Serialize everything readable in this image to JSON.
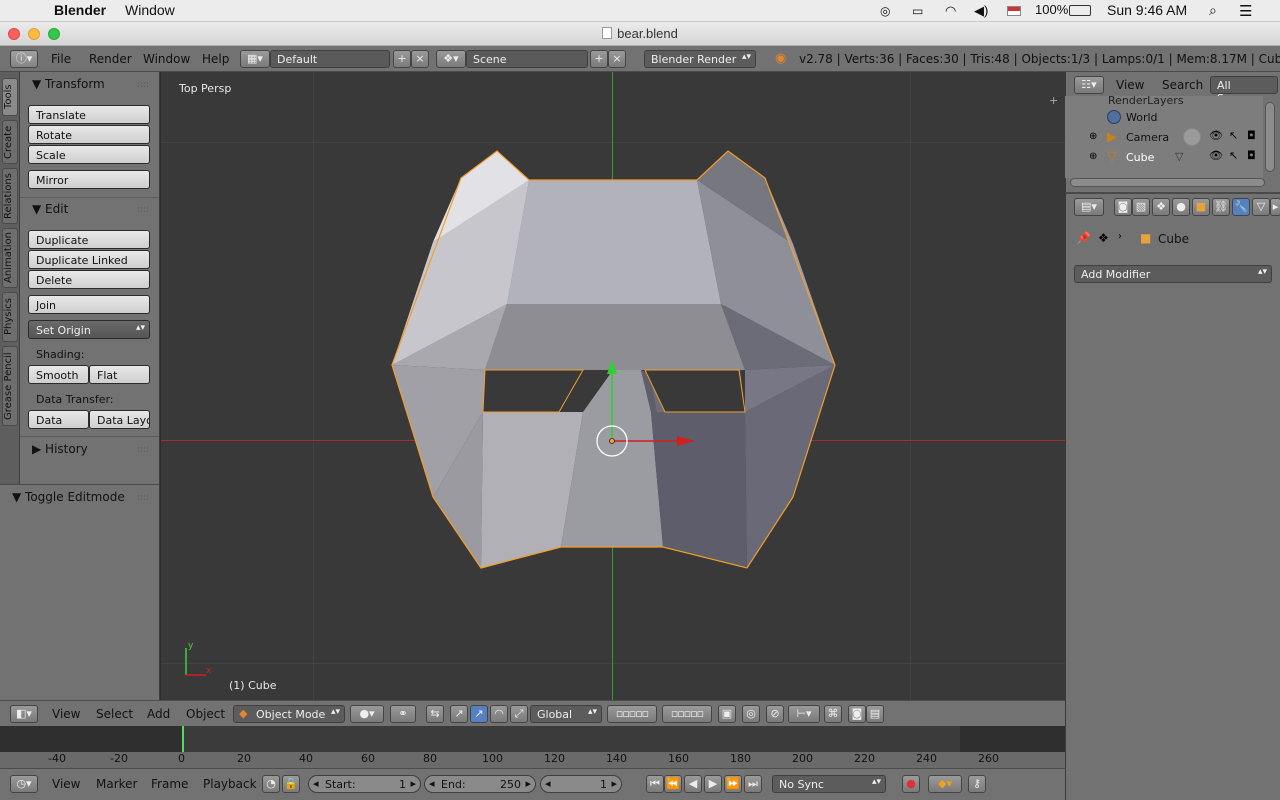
{
  "macbar": {
    "app_name": "Blender",
    "menu_window": "Window",
    "battery": "100%",
    "clock": "Sun 9:46 AM"
  },
  "window": {
    "title": "bear.blend"
  },
  "info_header": {
    "menus": [
      "File",
      "Render",
      "Window",
      "Help"
    ],
    "layout": "Default",
    "scene": "Scene",
    "engine": "Blender Render",
    "stats": "v2.78 | Verts:36 | Faces:30 | Tris:48 | Objects:1/3 | Lamps:0/1 | Mem:8.17M | Cube"
  },
  "left_tabs": [
    "Tools",
    "Create",
    "Relations",
    "Animation",
    "Physics",
    "Grease Pencil"
  ],
  "tool_panel": {
    "transform": {
      "title": "Transform",
      "buttons": [
        "Translate",
        "Rotate",
        "Scale",
        "Mirror"
      ]
    },
    "edit": {
      "title": "Edit",
      "buttons": [
        "Duplicate",
        "Duplicate Linked",
        "Delete",
        "Join"
      ],
      "set_origin": "Set Origin",
      "shading_label": "Shading:",
      "smooth": "Smooth",
      "flat": "Flat",
      "data_transfer_label": "Data Transfer:",
      "data": "Data",
      "data_layout": "Data Layo"
    },
    "history": "History",
    "toggle_editmode": "Toggle Editmode"
  },
  "viewport": {
    "view_name": "Top Persp",
    "object_label": "(1) Cube",
    "colors": {
      "bg": "#393939",
      "grid": "#434343",
      "x_axis": "#a03030",
      "y_axis": "#3a9a3a",
      "outline": "#f39d2a"
    }
  },
  "view3d_header": {
    "menus": [
      "View",
      "Select",
      "Add",
      "Object"
    ],
    "mode": "Object Mode",
    "orientation": "Global"
  },
  "timeline": {
    "ruler": [
      "-40",
      "-20",
      "0",
      "20",
      "40",
      "60",
      "80",
      "100",
      "120",
      "140",
      "160",
      "180",
      "200",
      "220",
      "240",
      "260"
    ],
    "menus": [
      "View",
      "Marker",
      "Frame",
      "Playback"
    ],
    "start_label": "Start:",
    "start": "1",
    "end_label": "End:",
    "end": "250",
    "current": "1",
    "sync": "No Sync"
  },
  "outliner": {
    "menus": [
      "View",
      "Search"
    ],
    "filter": "All Scenes",
    "items": [
      "RenderLayers",
      "World",
      "Camera",
      "Cube"
    ]
  },
  "properties": {
    "object_name": "Cube",
    "add_modifier": "Add Modifier"
  }
}
